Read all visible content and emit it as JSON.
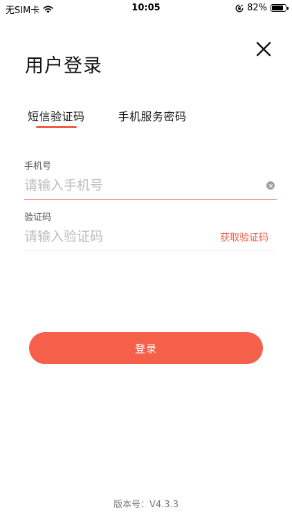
{
  "status_bar": {
    "carrier": "无SIM卡",
    "time": "10:05",
    "battery_percent": "82%",
    "battery_level": 0.82,
    "icons": [
      "wifi-icon",
      "orientation-lock-icon",
      "battery-icon"
    ]
  },
  "header": {
    "title": "用户登录",
    "close_icon": "close-icon"
  },
  "tabs": [
    {
      "label": "短信验证码",
      "active": true
    },
    {
      "label": "手机服务密码",
      "active": false
    }
  ],
  "form": {
    "phone": {
      "label": "手机号",
      "placeholder": "请输入手机号",
      "value": ""
    },
    "code": {
      "label": "验证码",
      "placeholder": "请输入验证码",
      "value": "",
      "get_code_label": "获取验证码"
    }
  },
  "login_button": {
    "label": "登录"
  },
  "footer": {
    "version": "版本号：V4.3.3"
  },
  "colors": {
    "accent": "#f5604a",
    "active_underline": "#f08b7b",
    "placeholder": "#bdbdbd"
  }
}
